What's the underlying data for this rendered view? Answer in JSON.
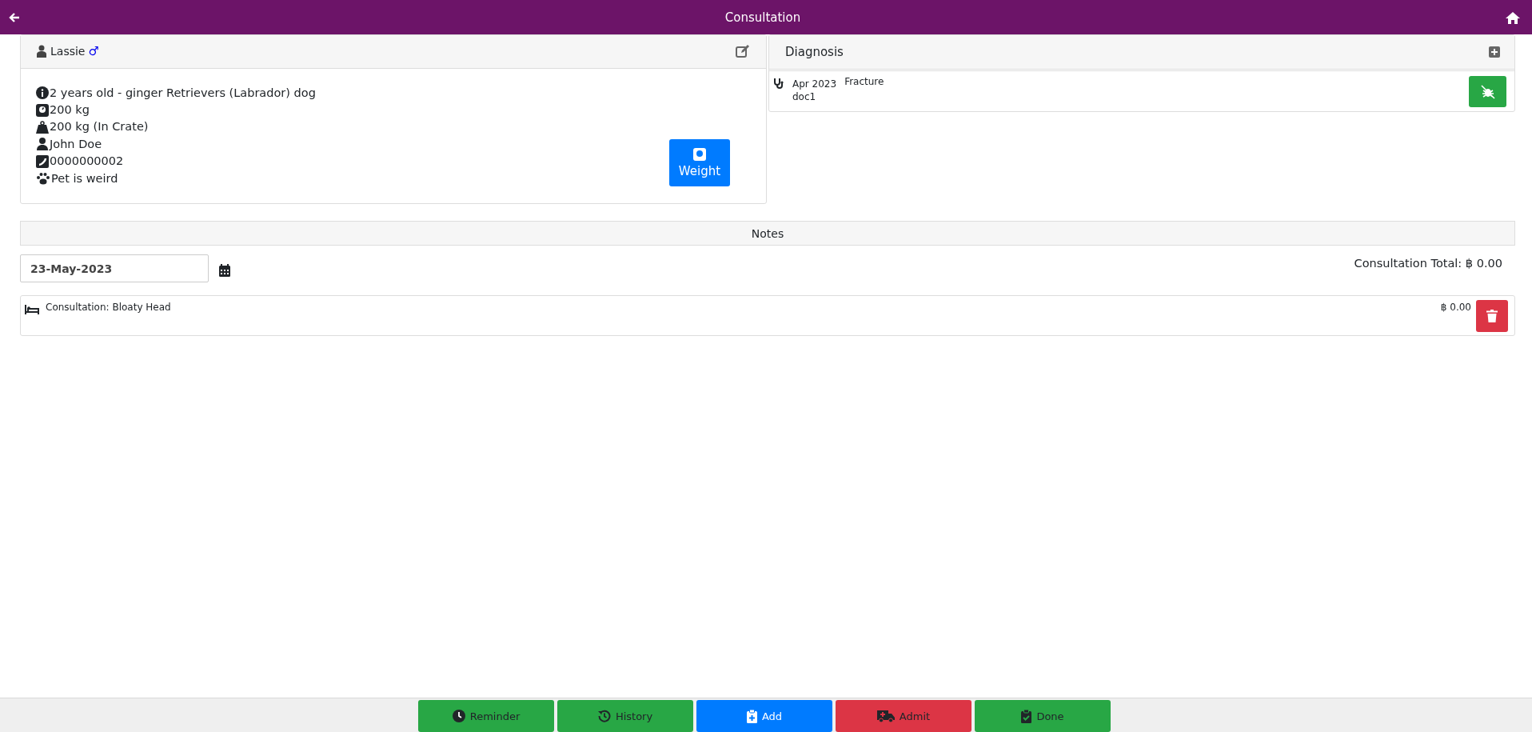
{
  "header": {
    "title": "Consultation"
  },
  "pet": {
    "name": "Lassie",
    "sex": "♂",
    "details": [
      {
        "kind": "info",
        "text": "2 years old - ginger Retrievers (Labrador) dog"
      },
      {
        "kind": "scale",
        "text": "200 kg"
      },
      {
        "kind": "bag",
        "text": "200 kg (In Crate)"
      },
      {
        "kind": "person",
        "text": "John Doe"
      },
      {
        "kind": "phone",
        "text": "0000000002"
      },
      {
        "kind": "paw",
        "text": "Pet is weird"
      }
    ],
    "weight_button": "Weight"
  },
  "diagnosis": {
    "title": "Diagnosis",
    "items": [
      {
        "date": "Apr 2023",
        "doctor": "doc1",
        "name": "Fracture"
      }
    ]
  },
  "notes": {
    "title": "Notes",
    "date": "23-May-2023",
    "total": "Consultation Total: ฿ 0.00",
    "items": [
      {
        "text": "Consultation: Bloaty Head",
        "price": "฿ 0.00"
      }
    ]
  },
  "footer_buttons": [
    {
      "kind": "clock",
      "label": "Reminder",
      "color": "#28a745"
    },
    {
      "kind": "history",
      "label": "History",
      "color": "#28a745"
    },
    {
      "kind": "clipboard-plus",
      "label": "Add",
      "color": "#007bff"
    },
    {
      "kind": "ambulance",
      "label": "Admit",
      "color": "#dc3545"
    },
    {
      "kind": "clipboard-check",
      "label": "Done",
      "color": "#28a745"
    }
  ]
}
